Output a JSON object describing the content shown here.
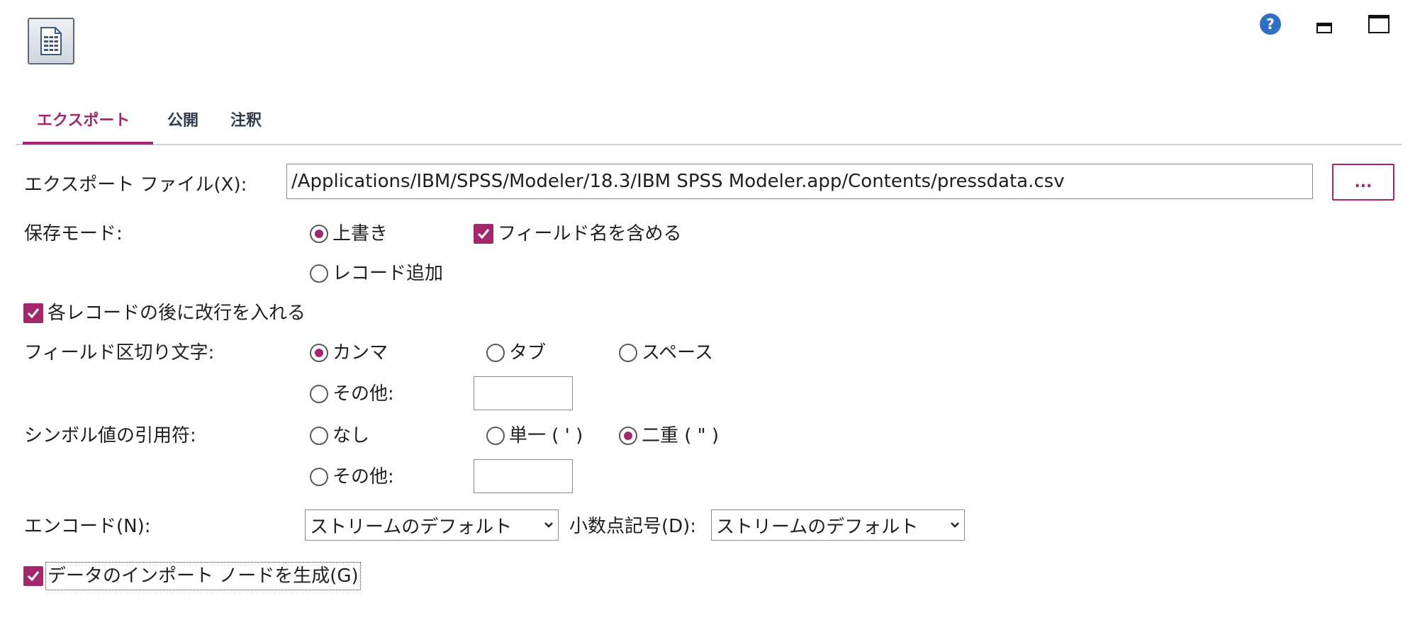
{
  "tabs": [
    {
      "label": "エクスポート",
      "active": true
    },
    {
      "label": "公開",
      "active": false
    },
    {
      "label": "注釈",
      "active": false
    }
  ],
  "icons": {
    "node": "export-file-node-icon",
    "help": "help-icon",
    "minimize": "minimize-icon",
    "maximize": "maximize-icon",
    "dropdown": "chevron-down-icon"
  },
  "colors": {
    "accent": "#a3276b",
    "help": "#2f6fc4"
  },
  "export_file": {
    "label": "エクスポート ファイル(X):",
    "value": "/Applications/IBM/SPSS/Modeler/18.3/IBM SPSS Modeler.app/Contents/pressdata.csv",
    "browse_label": "..."
  },
  "save_mode": {
    "label": "保存モード:",
    "overwrite": "上書き",
    "append": "レコード追加",
    "selected": "overwrite",
    "include_field_names": "フィールド名を含める",
    "include_field_names_checked": true
  },
  "newline": {
    "label": "各レコードの後に改行を入れる",
    "checked": true
  },
  "field_delimiter": {
    "label": "フィールド区切り文字:",
    "comma": "カンマ",
    "tab": "タブ",
    "space": "スペース",
    "other": "その他:",
    "other_value": "",
    "selected": "comma"
  },
  "quotes": {
    "label": "シンボル値の引用符:",
    "none": "なし",
    "single": "単一 ( ' )",
    "double": "二重 ( \" )",
    "other": "その他:",
    "other_value": "",
    "selected": "double"
  },
  "encoding": {
    "label": "エンコード(N):",
    "value": "ストリームのデフォルト"
  },
  "decimal": {
    "label": "小数点記号(D):",
    "value": "ストリームのデフォルト"
  },
  "generate_import": {
    "label": "データのインポート ノードを生成(G)",
    "checked": true
  }
}
